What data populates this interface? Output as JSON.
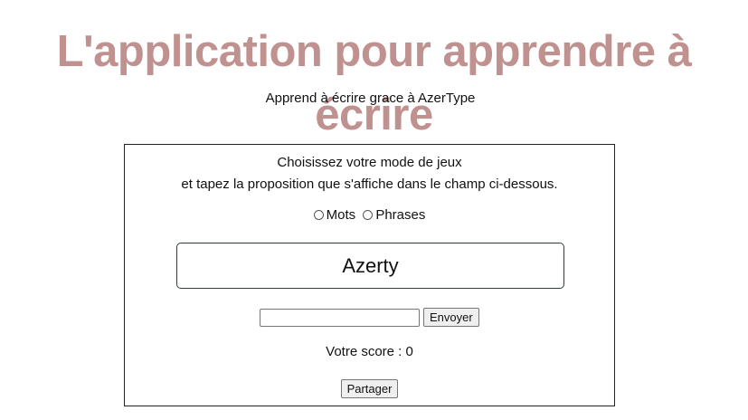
{
  "header": {
    "title": "L'application pour apprendre à écrire",
    "subtitle": "Apprend à écrire grace à AzerType"
  },
  "game": {
    "instruction_line1": "Choisissez votre mode de jeux",
    "instruction_line2": "et tapez la proposition que s'affiche dans le champ ci-dessous.",
    "modes": [
      {
        "label": "Mots",
        "selected": false
      },
      {
        "label": "Phrases",
        "selected": false
      }
    ],
    "proposal": "Azerty",
    "input_value": "",
    "send_label": "Envoyer",
    "score_label": "Votre score : 0",
    "share_label": "Partager"
  },
  "colors": {
    "title": "#bf918f",
    "border": "#222222"
  }
}
